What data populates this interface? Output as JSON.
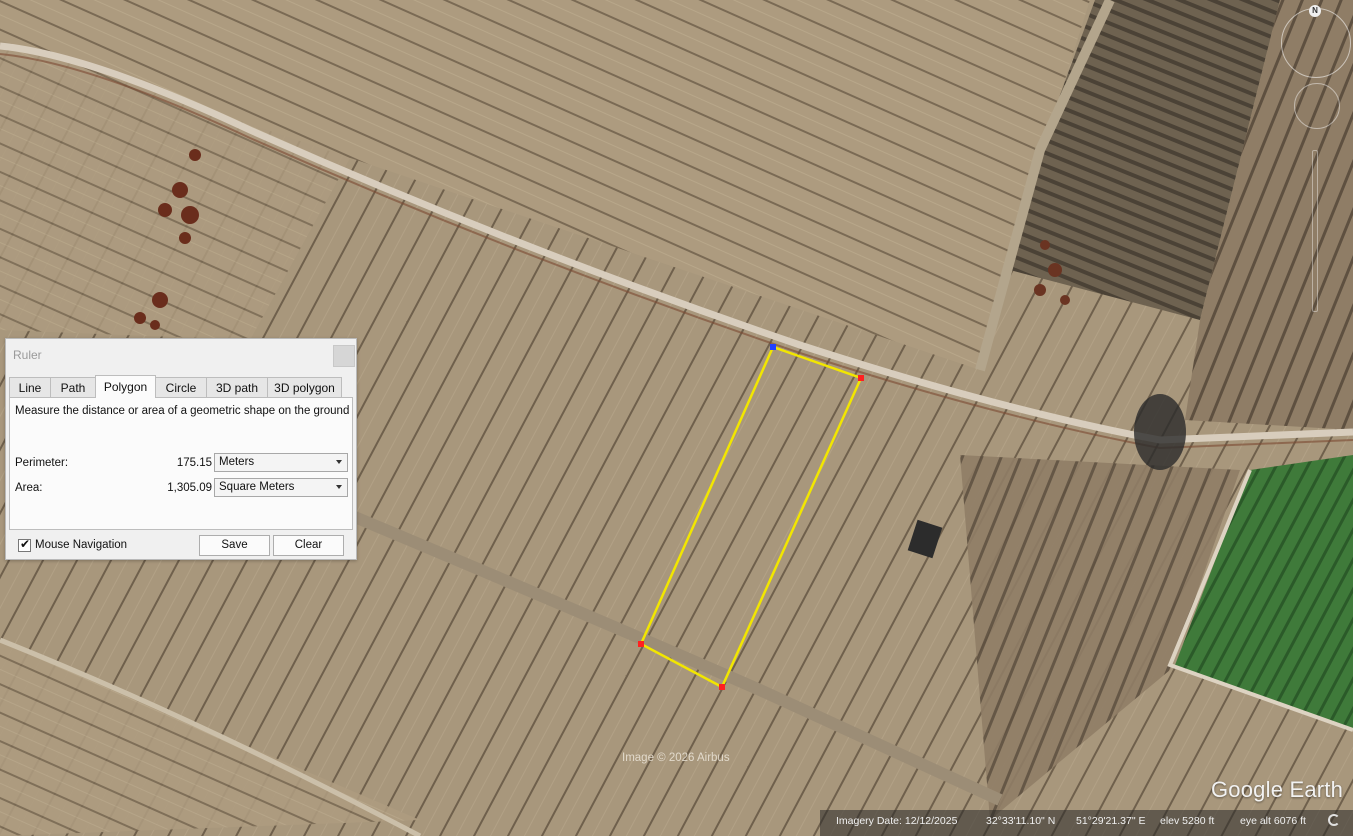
{
  "ruler": {
    "title": "Ruler",
    "tabs": [
      "Line",
      "Path",
      "Polygon",
      "Circle",
      "3D path",
      "3D polygon"
    ],
    "active_tab": "Polygon",
    "description": "Measure the distance or area of a geometric shape on the ground",
    "perimeter_label": "Perimeter:",
    "perimeter_value": "175.15",
    "perimeter_unit": "Meters",
    "area_label": "Area:",
    "area_value": "1,305.09",
    "area_unit": "Square Meters",
    "mouse_nav_label": "Mouse Navigation",
    "mouse_nav_checked": true,
    "save_label": "Save",
    "clear_label": "Clear"
  },
  "map": {
    "attribution": "Image © 2026 Airbus",
    "brand": "Google Earth",
    "compass_label": "N",
    "polygon_color": "#f2e600",
    "vertex_color": "#ff2020",
    "start_vertex_color": "#2040ff"
  },
  "status": {
    "imagery_date": "Imagery Date: 12/12/2025",
    "latitude": "32°33'11.10\" N",
    "longitude": "51°29'21.37\" E",
    "elevation": "elev  5280 ft",
    "eye_alt": "eye alt  6076 ft"
  }
}
